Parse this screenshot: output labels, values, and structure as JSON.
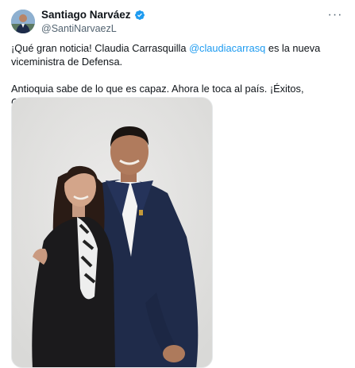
{
  "author": {
    "display_name": "Santiago Narváez",
    "handle": "@SantiNarvaezL",
    "verified": true,
    "avatar_icon": "profile-photo"
  },
  "menu": {
    "more_label": "···",
    "icon": "more-horizontal-icon"
  },
  "tweet": {
    "line1_before": "¡Qué gran noticia! Claudia Carrasquilla ",
    "mention": "@claudiacarrasq",
    "line1_after": " es la nueva viceministra de Defensa.",
    "line2": "Antioquia sabe de lo que es capaz. Ahora le toca al país. ¡Éxitos, Claudia!",
    "emoji": "clapping-hands-emoji"
  },
  "media": {
    "type": "photo",
    "alt_icon": "photo-two-people-embracing"
  },
  "colors": {
    "link": "#1d9bf0",
    "verified": "#1d9bf0",
    "muted": "#536471",
    "text": "#0f1419"
  }
}
